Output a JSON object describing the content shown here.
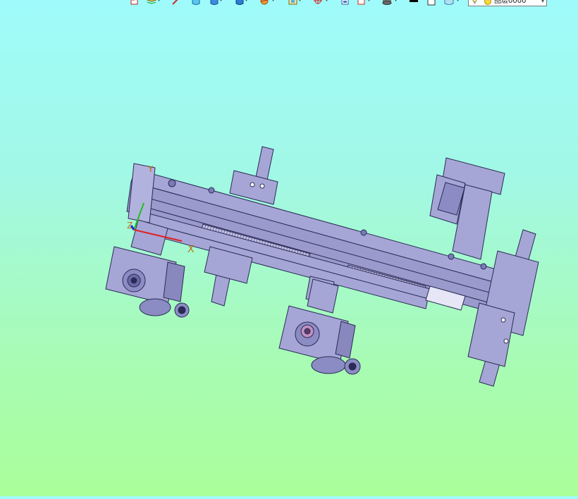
{
  "app": {
    "layer_selector": {
      "value": "图层0000",
      "icons": [
        "light-bulb-icon",
        "sun-icon",
        "dropdown-arrow-icon"
      ]
    },
    "toolbar_icons": [
      "undo-icon",
      "layers-icon",
      "pen-icon",
      "cube-view-icon",
      "box-icon",
      "solid-icon",
      "render-icon",
      "display-icon",
      "target-icon",
      "page-icon",
      "clipboard-icon",
      "database-icon",
      "black-square-icon",
      "white-square-icon",
      "shape-icon"
    ]
  },
  "viewport": {
    "background_top": "#9ffbfb",
    "background_bottom": "#aaff9a",
    "model_color": "#a6a6d6",
    "model_outline": "#2a2a55",
    "triad": {
      "x_label": "X",
      "y_label": "Y",
      "z_label": "Z",
      "x_color": "#e02020",
      "y_color": "#20c020",
      "z_color": "#2020e0"
    }
  }
}
